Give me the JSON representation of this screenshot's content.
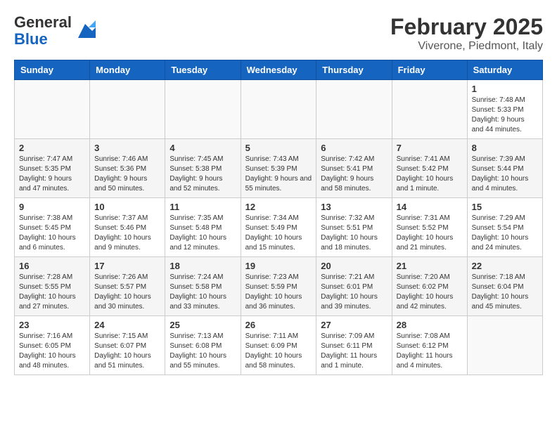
{
  "header": {
    "logo_line1": "General",
    "logo_line2": "Blue",
    "month": "February 2025",
    "location": "Viverone, Piedmont, Italy"
  },
  "days_of_week": [
    "Sunday",
    "Monday",
    "Tuesday",
    "Wednesday",
    "Thursday",
    "Friday",
    "Saturday"
  ],
  "weeks": [
    [
      {
        "day": "",
        "info": ""
      },
      {
        "day": "",
        "info": ""
      },
      {
        "day": "",
        "info": ""
      },
      {
        "day": "",
        "info": ""
      },
      {
        "day": "",
        "info": ""
      },
      {
        "day": "",
        "info": ""
      },
      {
        "day": "1",
        "info": "Sunrise: 7:48 AM\nSunset: 5:33 PM\nDaylight: 9 hours and 44 minutes."
      }
    ],
    [
      {
        "day": "2",
        "info": "Sunrise: 7:47 AM\nSunset: 5:35 PM\nDaylight: 9 hours and 47 minutes."
      },
      {
        "day": "3",
        "info": "Sunrise: 7:46 AM\nSunset: 5:36 PM\nDaylight: 9 hours and 50 minutes."
      },
      {
        "day": "4",
        "info": "Sunrise: 7:45 AM\nSunset: 5:38 PM\nDaylight: 9 hours and 52 minutes."
      },
      {
        "day": "5",
        "info": "Sunrise: 7:43 AM\nSunset: 5:39 PM\nDaylight: 9 hours and 55 minutes."
      },
      {
        "day": "6",
        "info": "Sunrise: 7:42 AM\nSunset: 5:41 PM\nDaylight: 9 hours and 58 minutes."
      },
      {
        "day": "7",
        "info": "Sunrise: 7:41 AM\nSunset: 5:42 PM\nDaylight: 10 hours and 1 minute."
      },
      {
        "day": "8",
        "info": "Sunrise: 7:39 AM\nSunset: 5:44 PM\nDaylight: 10 hours and 4 minutes."
      }
    ],
    [
      {
        "day": "9",
        "info": "Sunrise: 7:38 AM\nSunset: 5:45 PM\nDaylight: 10 hours and 6 minutes."
      },
      {
        "day": "10",
        "info": "Sunrise: 7:37 AM\nSunset: 5:46 PM\nDaylight: 10 hours and 9 minutes."
      },
      {
        "day": "11",
        "info": "Sunrise: 7:35 AM\nSunset: 5:48 PM\nDaylight: 10 hours and 12 minutes."
      },
      {
        "day": "12",
        "info": "Sunrise: 7:34 AM\nSunset: 5:49 PM\nDaylight: 10 hours and 15 minutes."
      },
      {
        "day": "13",
        "info": "Sunrise: 7:32 AM\nSunset: 5:51 PM\nDaylight: 10 hours and 18 minutes."
      },
      {
        "day": "14",
        "info": "Sunrise: 7:31 AM\nSunset: 5:52 PM\nDaylight: 10 hours and 21 minutes."
      },
      {
        "day": "15",
        "info": "Sunrise: 7:29 AM\nSunset: 5:54 PM\nDaylight: 10 hours and 24 minutes."
      }
    ],
    [
      {
        "day": "16",
        "info": "Sunrise: 7:28 AM\nSunset: 5:55 PM\nDaylight: 10 hours and 27 minutes."
      },
      {
        "day": "17",
        "info": "Sunrise: 7:26 AM\nSunset: 5:57 PM\nDaylight: 10 hours and 30 minutes."
      },
      {
        "day": "18",
        "info": "Sunrise: 7:24 AM\nSunset: 5:58 PM\nDaylight: 10 hours and 33 minutes."
      },
      {
        "day": "19",
        "info": "Sunrise: 7:23 AM\nSunset: 5:59 PM\nDaylight: 10 hours and 36 minutes."
      },
      {
        "day": "20",
        "info": "Sunrise: 7:21 AM\nSunset: 6:01 PM\nDaylight: 10 hours and 39 minutes."
      },
      {
        "day": "21",
        "info": "Sunrise: 7:20 AM\nSunset: 6:02 PM\nDaylight: 10 hours and 42 minutes."
      },
      {
        "day": "22",
        "info": "Sunrise: 7:18 AM\nSunset: 6:04 PM\nDaylight: 10 hours and 45 minutes."
      }
    ],
    [
      {
        "day": "23",
        "info": "Sunrise: 7:16 AM\nSunset: 6:05 PM\nDaylight: 10 hours and 48 minutes."
      },
      {
        "day": "24",
        "info": "Sunrise: 7:15 AM\nSunset: 6:07 PM\nDaylight: 10 hours and 51 minutes."
      },
      {
        "day": "25",
        "info": "Sunrise: 7:13 AM\nSunset: 6:08 PM\nDaylight: 10 hours and 55 minutes."
      },
      {
        "day": "26",
        "info": "Sunrise: 7:11 AM\nSunset: 6:09 PM\nDaylight: 10 hours and 58 minutes."
      },
      {
        "day": "27",
        "info": "Sunrise: 7:09 AM\nSunset: 6:11 PM\nDaylight: 11 hours and 1 minute."
      },
      {
        "day": "28",
        "info": "Sunrise: 7:08 AM\nSunset: 6:12 PM\nDaylight: 11 hours and 4 minutes."
      },
      {
        "day": "",
        "info": ""
      }
    ]
  ]
}
